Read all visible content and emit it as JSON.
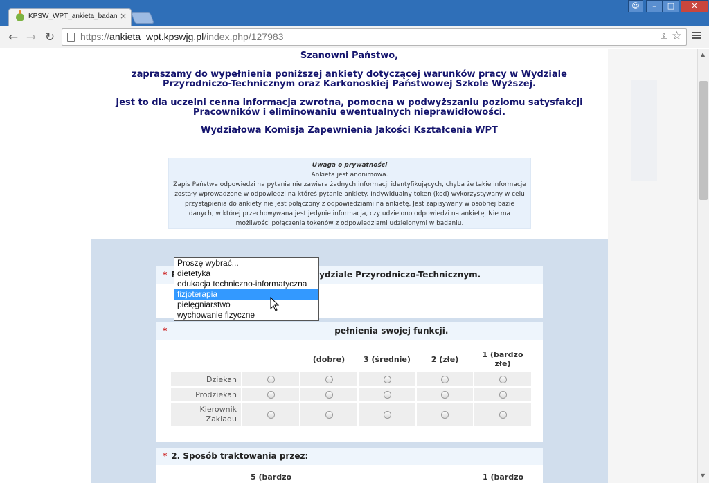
{
  "browser": {
    "tab_title": "KPSW_WPT_ankieta_badani",
    "tab_close": "×",
    "url_scheme": "https://",
    "url_host": "ankieta_wpt.kpswjg.pl",
    "url_path": "/index.php/127983"
  },
  "intro": {
    "greeting": "Szanowni Państwo,",
    "invite": "zapraszamy do wypełnienia poniższej ankiety dotyczącej warunków pracy w Wydziale Przyrodniczo-Technicznym oraz Karkonoskiej Państwowej Szkole Wyższej.",
    "info": "Jest to dla uczelni cenna informacja zwrotna, pomocna w podwyższaniu poziomu satysfakcji Pracowników i eliminowaniu ewentualnych nieprawidłowości.",
    "signature": "Wydziałowa Komisja Zapewnienia Jakości Kształcenia WPT"
  },
  "privacy": {
    "title": "Uwaga o prywatności",
    "anon": "Ankieta jest anonimowa.",
    "text": "Zapis Państwa odpowiedzi na pytania nie zawiera żadnych informacji identyfikujących, chyba że takie informacje zostały wprowadzone w odpowiedzi na któreś pytanie ankiety. Indywidualny token (kod) wykorzystywany w celu przystąpienia do ankiety nie jest połączony z odpowiedziami na ankietę. Jest zapisywany w osobnej bazie danych, w której przechowywana jest jedynie informacja, czy udzielono odpowiedzi na ankietę. Nie ma możliwości połączenia tokenów z odpowiedziami udzielonymi w badaniu."
  },
  "q0": {
    "required_mark": "*",
    "text": "Proszę wybrać swój zakład w Wydziale Przyrodniczo-Technicznym.",
    "selected_value": "fizjoterapia",
    "options": [
      "Proszę wybrać...",
      "dietetyka",
      "edukacja techniczno-informatyczna",
      "fizjoterapia",
      "pielęgniarstwo",
      "wychowanie fizyczne"
    ],
    "highlighted_index": 3
  },
  "q1": {
    "required_mark": "*",
    "text_visible": "pełnienia swojej funkcji.",
    "columns": [
      "(dobre)",
      "3 (średnie)",
      "2 (złe)",
      "1 (bardzo złe)"
    ],
    "rows": [
      "Dziekan",
      "Prodziekan",
      "Kierownik Zakładu"
    ]
  },
  "q2": {
    "required_mark": "*",
    "text": "2. Sposób traktowania przez:",
    "col_first": "5 (bardzo",
    "col_last": "1 (bardzo"
  }
}
